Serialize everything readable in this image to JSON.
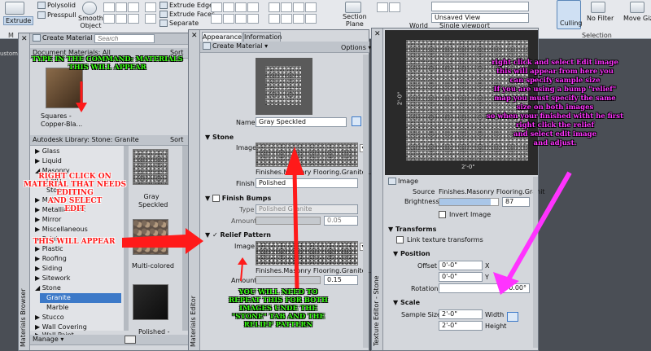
{
  "ribbon": {
    "extrude": "Extrude",
    "presspull": "Presspull",
    "smooth_object": "Smooth\nObject",
    "polysolid": "Polysolid",
    "extrude_edges": "Extrude Edges",
    "extrude_faces": "Extrude Faces",
    "separate": "Separate",
    "section_plane": "Section\nPlane",
    "unsaved_view": "Unsaved View",
    "world": "World",
    "single_viewport": "Single viewport",
    "culling": "Culling",
    "no_filter": "No Filter",
    "move_gizmo": "Move Giz",
    "selection": "Selection",
    "group_m": "M",
    "custom": "ustom"
  },
  "materials_browser": {
    "create_material": "Create Material",
    "search_placeholder": "Search",
    "doc_materials_all": "Document Materials: All",
    "sort": "Sort",
    "doc_swatch_label": "Squares - Copper-Bla...",
    "library_header": "Autodesk Library: Stone: Granite",
    "tree": [
      "Glass",
      "Liquid",
      "Masonry",
      "CMU",
      "Stone",
      "Metal",
      "Metallic Paint",
      "Mirror",
      "Miscellaneous",
      "Paint",
      "Plastic",
      "Roofing",
      "Siding",
      "Sitework",
      "Stone",
      "Granite",
      "Marble",
      "Stucco",
      "Wall Covering",
      "Wall Paint"
    ],
    "tree_collapsed_glyph": "▶",
    "tree_expanded_glyph": "◢",
    "swatches": [
      "Gray Speckled",
      "Multi-colored",
      "Polished -"
    ],
    "manage": "Manage",
    "tab_label": "Materials Browser"
  },
  "materials_editor": {
    "tab_appearance": "Appearance",
    "tab_information": "Information",
    "create_material": "Create Material",
    "options": "Options",
    "name_label": "Name",
    "name_value": "Gray Speckled",
    "stone_section": "Stone",
    "image_label": "Image",
    "stone_image_caption": "Finishes.Masonry Flooring.Granite...",
    "finish_label": "Finish",
    "finish_value": "Polished",
    "finish_bumps": "Finish Bumps",
    "type_label": "Type",
    "type_value": "Polished Granite",
    "amount_label": "Amount",
    "bumps_amount": "0.05",
    "relief_pattern": "Relief Pattern",
    "relief_caption": "Finishes.Masonry Flooring.Granite...",
    "relief_amount": "0.15",
    "relief_check_glyph": "✓",
    "tab_label": "Materials Editor"
  },
  "texture_editor": {
    "dim_vertical": "2'-0\"",
    "dim_horizontal": "2'-0\"",
    "image_section": "Image",
    "source_label": "Source",
    "source_value": "Finishes.Masonry Flooring.Granit",
    "brightness_label": "Brightness",
    "brightness_value": "87",
    "brightness_percent": 0.87,
    "invert_image": "Invert Image",
    "transforms": "Transforms",
    "link_transforms": "Link texture transforms",
    "position": "Position",
    "offset_label": "Offset",
    "offset_x": "0'-0\"",
    "offset_y": "0'-0\"",
    "x": "X",
    "y": "Y",
    "rotation_label": "Rotation",
    "rotation_value": "0.00°",
    "scale": "Scale",
    "sample_size_label": "Sample Size",
    "sample_width": "2'-0\"",
    "sample_height": "2'-0\"",
    "width": "Width",
    "height": "Height",
    "tab_label": "Texture Editor - Stone"
  },
  "annotations": {
    "green_top": "TYPE IN THE COMMAND: MATERIALS\nTHIS WILL APPEAR",
    "red_left": "RIGHT CLICK ON\nMATERIAL THAT NEEDS\nEDITING\nAND SELECT\nEDIT",
    "red_this": "THIS WILL APPEAR",
    "green_bottom": "YOU WILL NEED TO\nREPEAT THIS FOR BOTH\nIMAGES UNDE THE\n\"STONE\" TAB AND THE\nRELIEF PATTERN",
    "magenta": "right click and select Edit image\nthis will appear from here you\ncan specify sample size\nIf you are using a bump \"relief\"\nmap you must specify the same\nsize on both images\nso when your finished witht he first\nright click the relief\nand select edit image\nand adjust."
  },
  "colors": {
    "annotation_green": "#39ff14",
    "annotation_red": "#ff1a1a",
    "annotation_magenta": "#ff33ff",
    "selection_blue": "#3c79c8"
  }
}
